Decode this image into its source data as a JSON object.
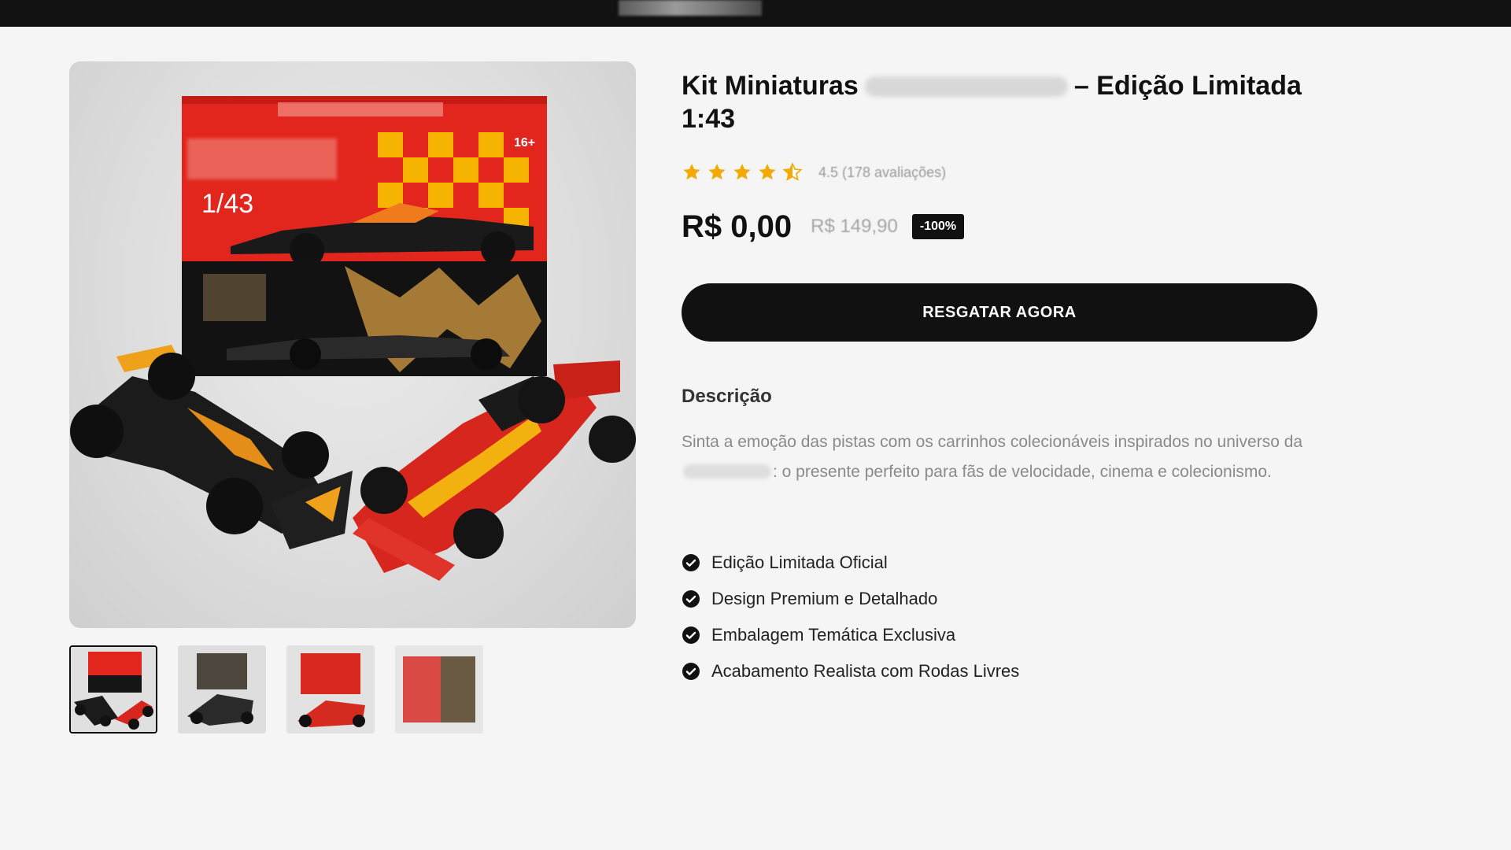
{
  "colors": {
    "background": "#f5f5f5",
    "topbar": "#121212",
    "accent": "#111111",
    "star": "#f5a800",
    "muted_text": "#8a8a8a"
  },
  "gallery": {
    "main_image_label": "1/43",
    "main_image_badge": "16+",
    "thumbnails": [
      {
        "name": "thumbnail-1",
        "active": true
      },
      {
        "name": "thumbnail-2",
        "active": false
      },
      {
        "name": "thumbnail-3",
        "active": false
      },
      {
        "name": "thumbnail-4",
        "active": false
      }
    ]
  },
  "product": {
    "title_prefix": "Kit Miniaturas",
    "title_suffix": "– Edição Limitada 1:43",
    "rating_value": 4.5,
    "rating_max": 5,
    "rating_text": "4.5 (178 avaliações)",
    "price_current": "R$ 0,00",
    "price_original": "R$ 149,90",
    "discount_badge": "-100%",
    "cta_label": "RESGATAR AGORA"
  },
  "description": {
    "heading": "Descrição",
    "text_before": "Sinta a emoção das pistas com os carrinhos colecionáveis inspirados no universo da",
    "text_after": ": o presente perfeito para fãs de velocidade, cinema e colecionismo.",
    "features": [
      "Edição Limitada Oficial",
      "Design Premium e Detalhado",
      "Embalagem Temática Exclusiva",
      "Acabamento Realista com Rodas Livres"
    ],
    "feature_icon": "check-circle-icon"
  }
}
